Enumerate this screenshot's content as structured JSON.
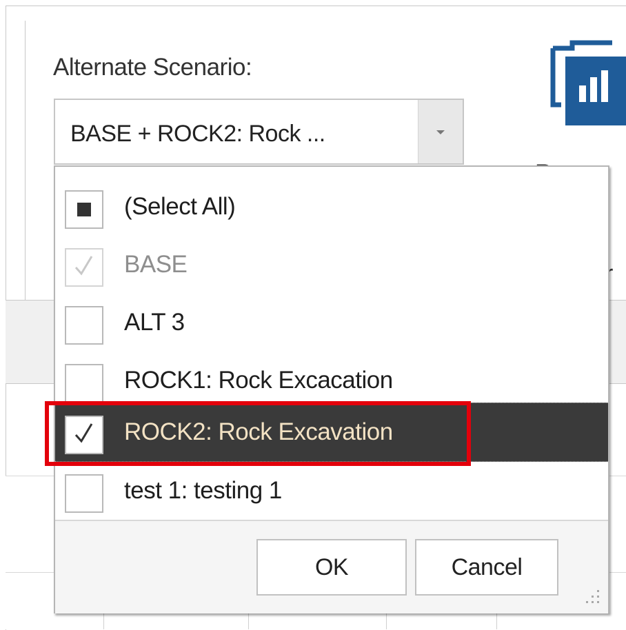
{
  "scenario": {
    "label": "Alternate Scenario:",
    "selected_value": "BASE + ROCK2: Rock ..."
  },
  "right_panel": {
    "partial_text_1": "R",
    "partial_text_2": "r"
  },
  "dropdown": {
    "items": [
      {
        "label": "(Select All)",
        "state": "indeterminate"
      },
      {
        "label": "BASE",
        "state": "checked-disabled"
      },
      {
        "label": "ALT 3",
        "state": "unchecked"
      },
      {
        "label": "ROCK1: Rock Excacation",
        "state": "unchecked"
      },
      {
        "label": "ROCK2: Rock Excavation",
        "state": "checked",
        "highlighted": true
      },
      {
        "label": "test 1: testing 1",
        "state": "unchecked"
      }
    ],
    "ok_label": "OK",
    "cancel_label": "Cancel"
  },
  "colors": {
    "highlight_box": "#e3000b",
    "selected_row_bg": "#3a3a3a",
    "selected_row_text": "#f3e2c4",
    "icon_blue": "#1f5c99"
  },
  "icons": [
    "chevron-down-icon",
    "report-chart-icon",
    "checkmark-icon",
    "indeterminate-square-icon",
    "resize-grip-icon"
  ]
}
